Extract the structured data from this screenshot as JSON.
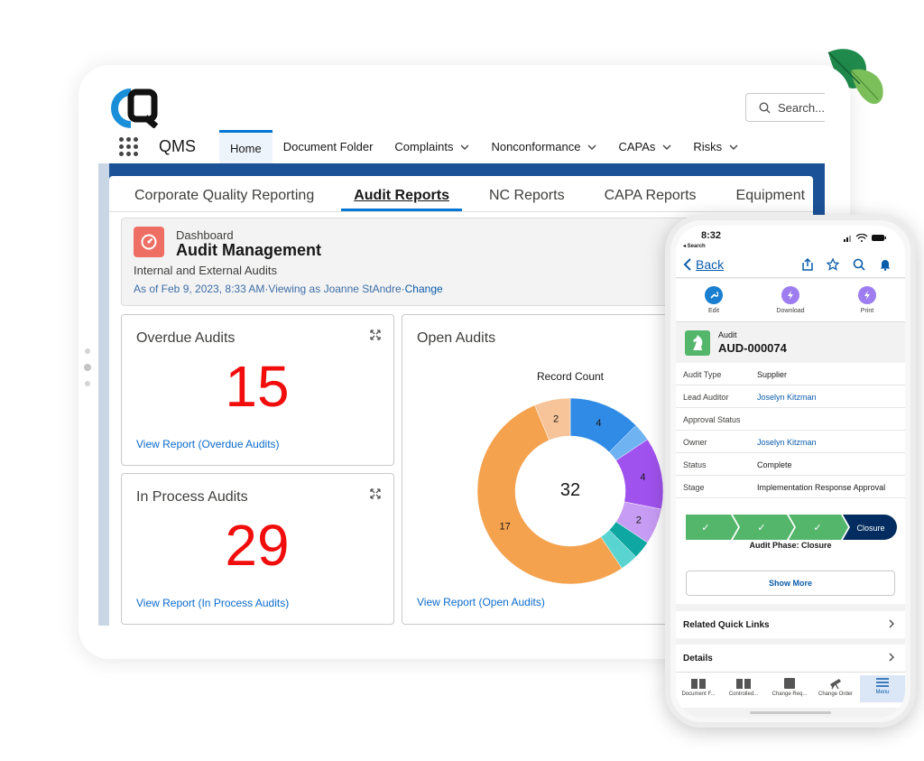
{
  "app": {
    "name": "QMS",
    "search_placeholder": "Search..."
  },
  "nav": {
    "items": [
      {
        "label": "Home",
        "active": true,
        "dropdown": false
      },
      {
        "label": "Document Folder",
        "active": false,
        "dropdown": false
      },
      {
        "label": "Complaints",
        "active": false,
        "dropdown": true
      },
      {
        "label": "Nonconformance",
        "active": false,
        "dropdown": true
      },
      {
        "label": "CAPAs",
        "active": false,
        "dropdown": true
      },
      {
        "label": "Risks",
        "active": false,
        "dropdown": true
      }
    ]
  },
  "tabs": [
    {
      "label": "Corporate Quality Reporting",
      "active": false
    },
    {
      "label": "Audit Reports",
      "active": true
    },
    {
      "label": "NC Reports",
      "active": false
    },
    {
      "label": "CAPA Reports",
      "active": false
    },
    {
      "label": "Equipment",
      "active": false
    }
  ],
  "dashboard": {
    "label": "Dashboard",
    "title": "Audit Management",
    "subtitle": "Internal and External Audits",
    "as_of": "As of Feb 9, 2023, 8:33 AM·Viewing as Joanne StAndre·",
    "change_link": "Change"
  },
  "cards": {
    "overdue": {
      "title": "Overdue Audits",
      "value": "15",
      "link": "View Report (Overdue Audits)"
    },
    "in_process": {
      "title": "In Process Audits",
      "value": "29",
      "link": "View Report (In Process Audits)"
    },
    "open": {
      "title": "Open Audits",
      "link": "View Report (Open Audits)"
    }
  },
  "chart_data": {
    "type": "pie",
    "title": "Record Count",
    "total_label": "32",
    "slices": [
      {
        "value": 4,
        "label": "4",
        "color": "#2f8be6"
      },
      {
        "value": 1,
        "label": "",
        "color": "#6fb3f2"
      },
      {
        "value": 4,
        "label": "4",
        "color": "#a052ee"
      },
      {
        "value": 2,
        "label": "2",
        "color": "#c79cf4"
      },
      {
        "value": 1,
        "label": "",
        "color": "#0ea7a1"
      },
      {
        "value": 1,
        "label": "",
        "color": "#5ad4d0"
      },
      {
        "value": 17,
        "label": "17",
        "color": "#f5a24f"
      },
      {
        "value": 2,
        "label": "2",
        "color": "#f7c499"
      }
    ]
  },
  "phone": {
    "time": "8:32",
    "status_search": "◂ Search",
    "back": "Back",
    "actions": [
      {
        "label": "Edit",
        "icon": "wrench-icon",
        "color": "#1b7fd1"
      },
      {
        "label": "Download",
        "icon": "bolt-icon",
        "color": "#9d7df0"
      },
      {
        "label": "Print",
        "icon": "bolt-icon",
        "color": "#9d7df0"
      }
    ],
    "record": {
      "object": "Audit",
      "name": "AUD-000074"
    },
    "fields": [
      {
        "label": "Audit Type",
        "value": "Supplier",
        "link": false
      },
      {
        "label": "Lead Auditor",
        "value": "Joselyn Kitzman",
        "link": true
      },
      {
        "label": "Approval Status",
        "value": "",
        "link": false
      },
      {
        "label": "Owner",
        "value": "Joselyn Kitzman",
        "link": true
      },
      {
        "label": "Status",
        "value": "Complete",
        "link": false
      },
      {
        "label": "Stage",
        "value": "Implementation Response Approval",
        "link": false
      }
    ],
    "path": {
      "steps": [
        "✓",
        "✓",
        "✓",
        "Closure"
      ],
      "phase_label": "Audit Phase: Closure",
      "show_more": "Show More"
    },
    "sections": [
      "Related Quick Links",
      "Details"
    ],
    "tabbar": [
      {
        "label": "Document F...",
        "active": false
      },
      {
        "label": "Controlled...",
        "active": false
      },
      {
        "label": "Change Req...",
        "active": false
      },
      {
        "label": "Change Order",
        "active": false
      },
      {
        "label": "Menu",
        "active": true
      }
    ]
  },
  "colors": {
    "accent": "#0176d3",
    "metric_red": "#f20d0d",
    "frame_blue": "#1b5297"
  }
}
